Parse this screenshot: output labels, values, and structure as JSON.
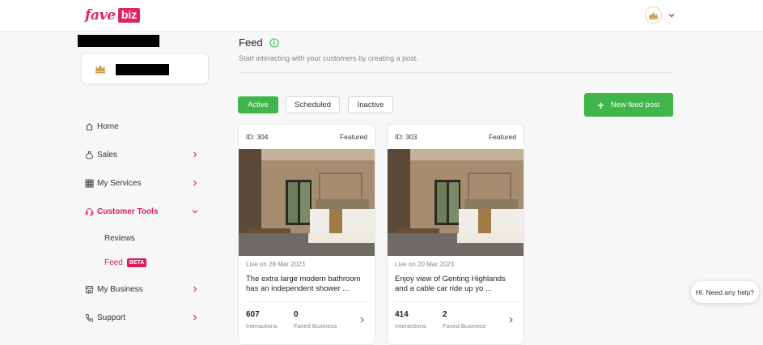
{
  "brand": {
    "fave": "fave",
    "biz": "biz",
    "accent": "#e0245e"
  },
  "sidebar": {
    "items": [
      {
        "label": "Home",
        "icon": "home-icon"
      },
      {
        "label": "Sales",
        "icon": "money-bag-icon"
      },
      {
        "label": "My Services",
        "icon": "grid-icon"
      },
      {
        "label": "Customer Tools",
        "icon": "headset-icon"
      },
      {
        "label": "My Business",
        "icon": "store-icon"
      },
      {
        "label": "Support",
        "icon": "phone-icon"
      }
    ],
    "subitems": [
      {
        "label": "Reviews"
      },
      {
        "label": "Feed",
        "badge": "BETA"
      }
    ]
  },
  "main": {
    "title": "Feed",
    "subtitle": "Start interacting with your customers by creating a post.",
    "tabs": [
      {
        "label": "Active"
      },
      {
        "label": "Scheduled"
      },
      {
        "label": "Inactive"
      }
    ],
    "new_post_label": "New feed post",
    "posts": [
      {
        "id": "ID: 304",
        "featured": "Featured",
        "live": "Live on 28 Mar 2023",
        "desc_line1": "The extra large modern bathroom",
        "desc_line2": "has an independent shower ...",
        "interactions": "607",
        "interactions_label": "Interactions",
        "faved": "0",
        "faved_label": "Faved Business"
      },
      {
        "id": "ID: 303",
        "featured": "Featured",
        "live": "Live on 20 Mar 2023",
        "desc_line1": "Enjoy view of Genting Highlands",
        "desc_line2": "and a cable car ride up yo ...",
        "interactions": "414",
        "interactions_label": "Interactions",
        "faved": "2",
        "faved_label": "Faved Business"
      }
    ]
  },
  "help": {
    "label": "Hi. Need any help?"
  },
  "colors": {
    "green": "#3fb54a",
    "pink": "#d81e5b"
  }
}
